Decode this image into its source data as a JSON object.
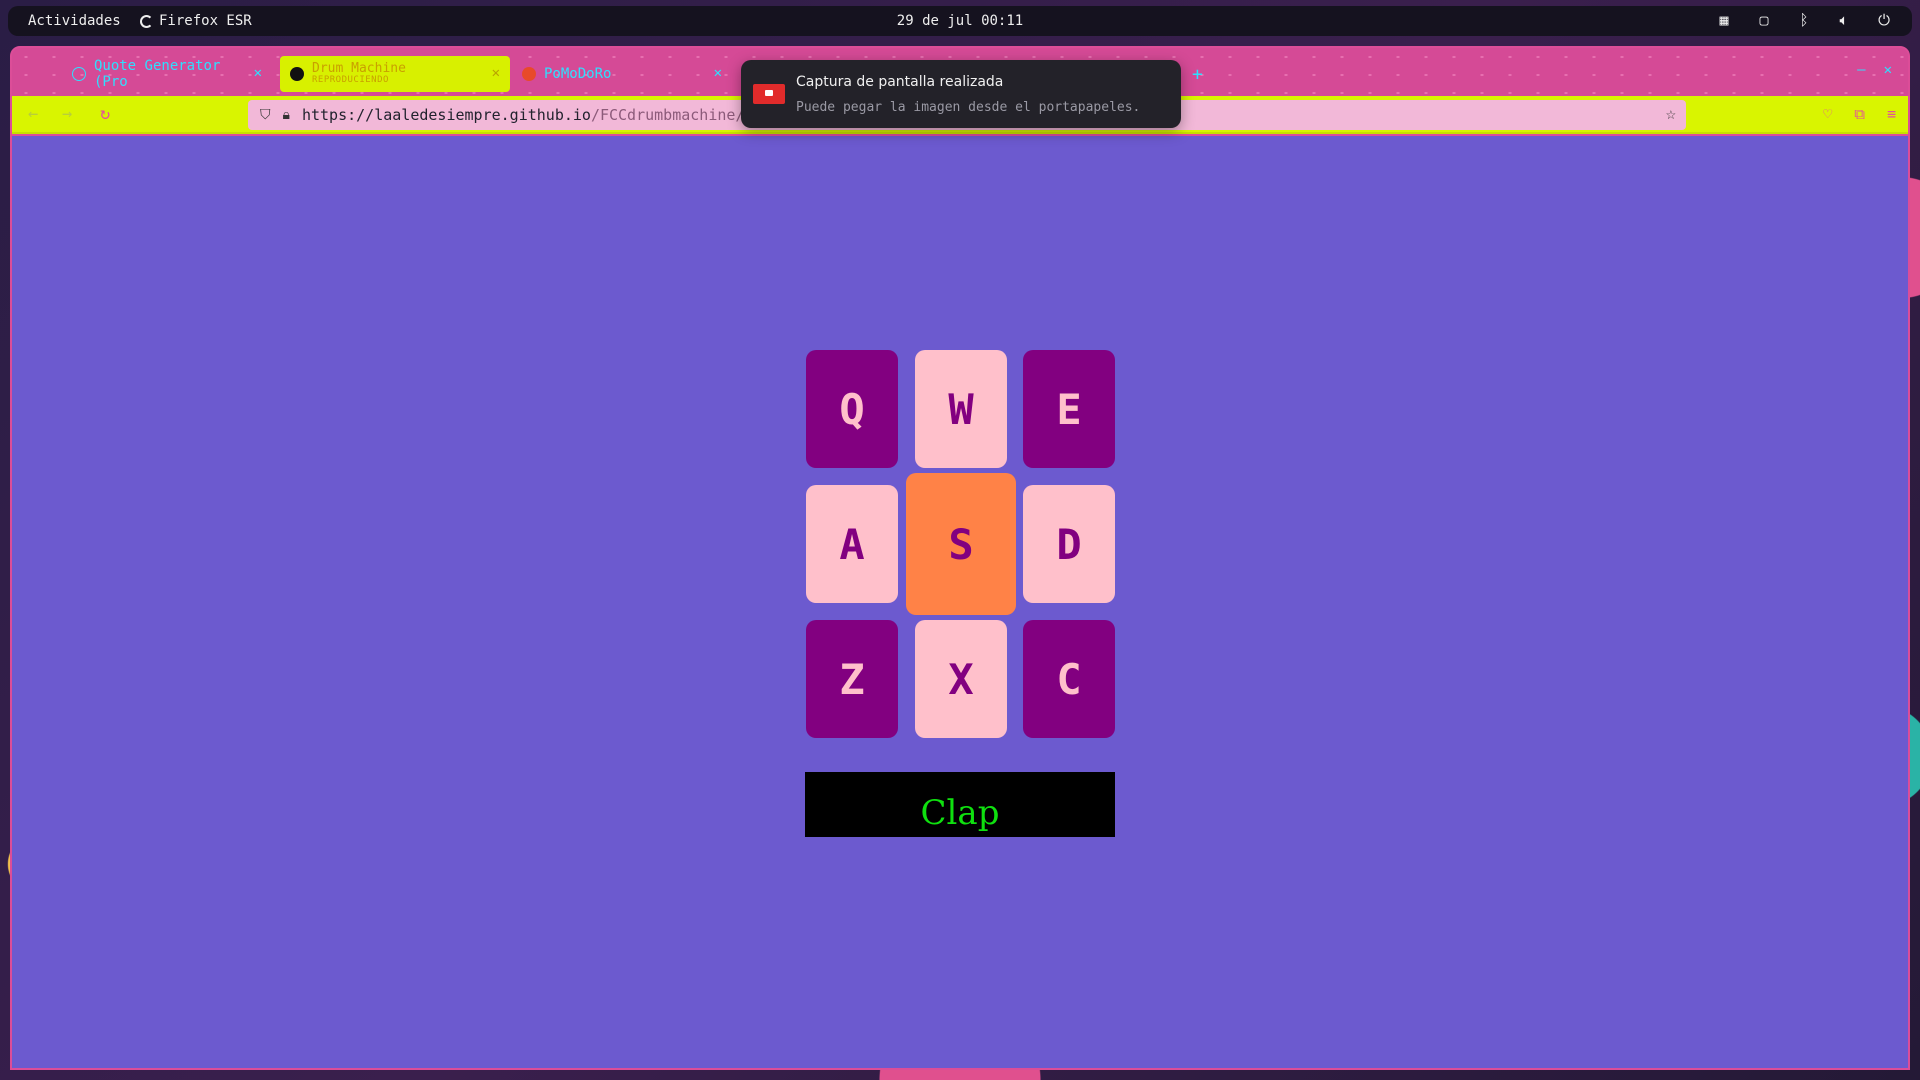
{
  "topbar": {
    "activities": "Actividades",
    "app_name": "Firefox ESR",
    "clock": "29 de jul 00:11",
    "tray_icons": [
      "app-grid-icon",
      "screen-icon",
      "bluetooth-icon",
      "volume-icon",
      "power-icon"
    ]
  },
  "tabs": [
    {
      "label": "Quote Generator (Pro",
      "favicon": "quote-icon"
    },
    {
      "label": "Drum Machine",
      "sublabel": "REPRODUCIENDO",
      "favicon": "drum-icon",
      "active": true
    },
    {
      "label": "PoMoDoRo",
      "favicon": "tomato-icon"
    }
  ],
  "navbar": {
    "url_host": "https://laaledesiempre.github.io",
    "url_path": "/FCCdrumbmachine/"
  },
  "notification": {
    "title": "Captura de pantalla realizada",
    "body": "Puede pegar la imagen desde el portapapeles."
  },
  "drum": {
    "pads": [
      {
        "key": "Q",
        "style": "dark"
      },
      {
        "key": "W",
        "style": "light"
      },
      {
        "key": "E",
        "style": "dark"
      },
      {
        "key": "A",
        "style": "light"
      },
      {
        "key": "S",
        "style": "active"
      },
      {
        "key": "D",
        "style": "light"
      },
      {
        "key": "Z",
        "style": "dark"
      },
      {
        "key": "X",
        "style": "light"
      },
      {
        "key": "C",
        "style": "dark"
      }
    ],
    "display": "Clap"
  },
  "colors": {
    "page_bg": "#6c5acf",
    "pad_dark": "#820080",
    "pad_light": "#ffc0cb",
    "pad_active": "#ff8247",
    "display_text": "#0fe00f",
    "navbar": "#d9f500",
    "tabstrip": "#d54a96"
  }
}
